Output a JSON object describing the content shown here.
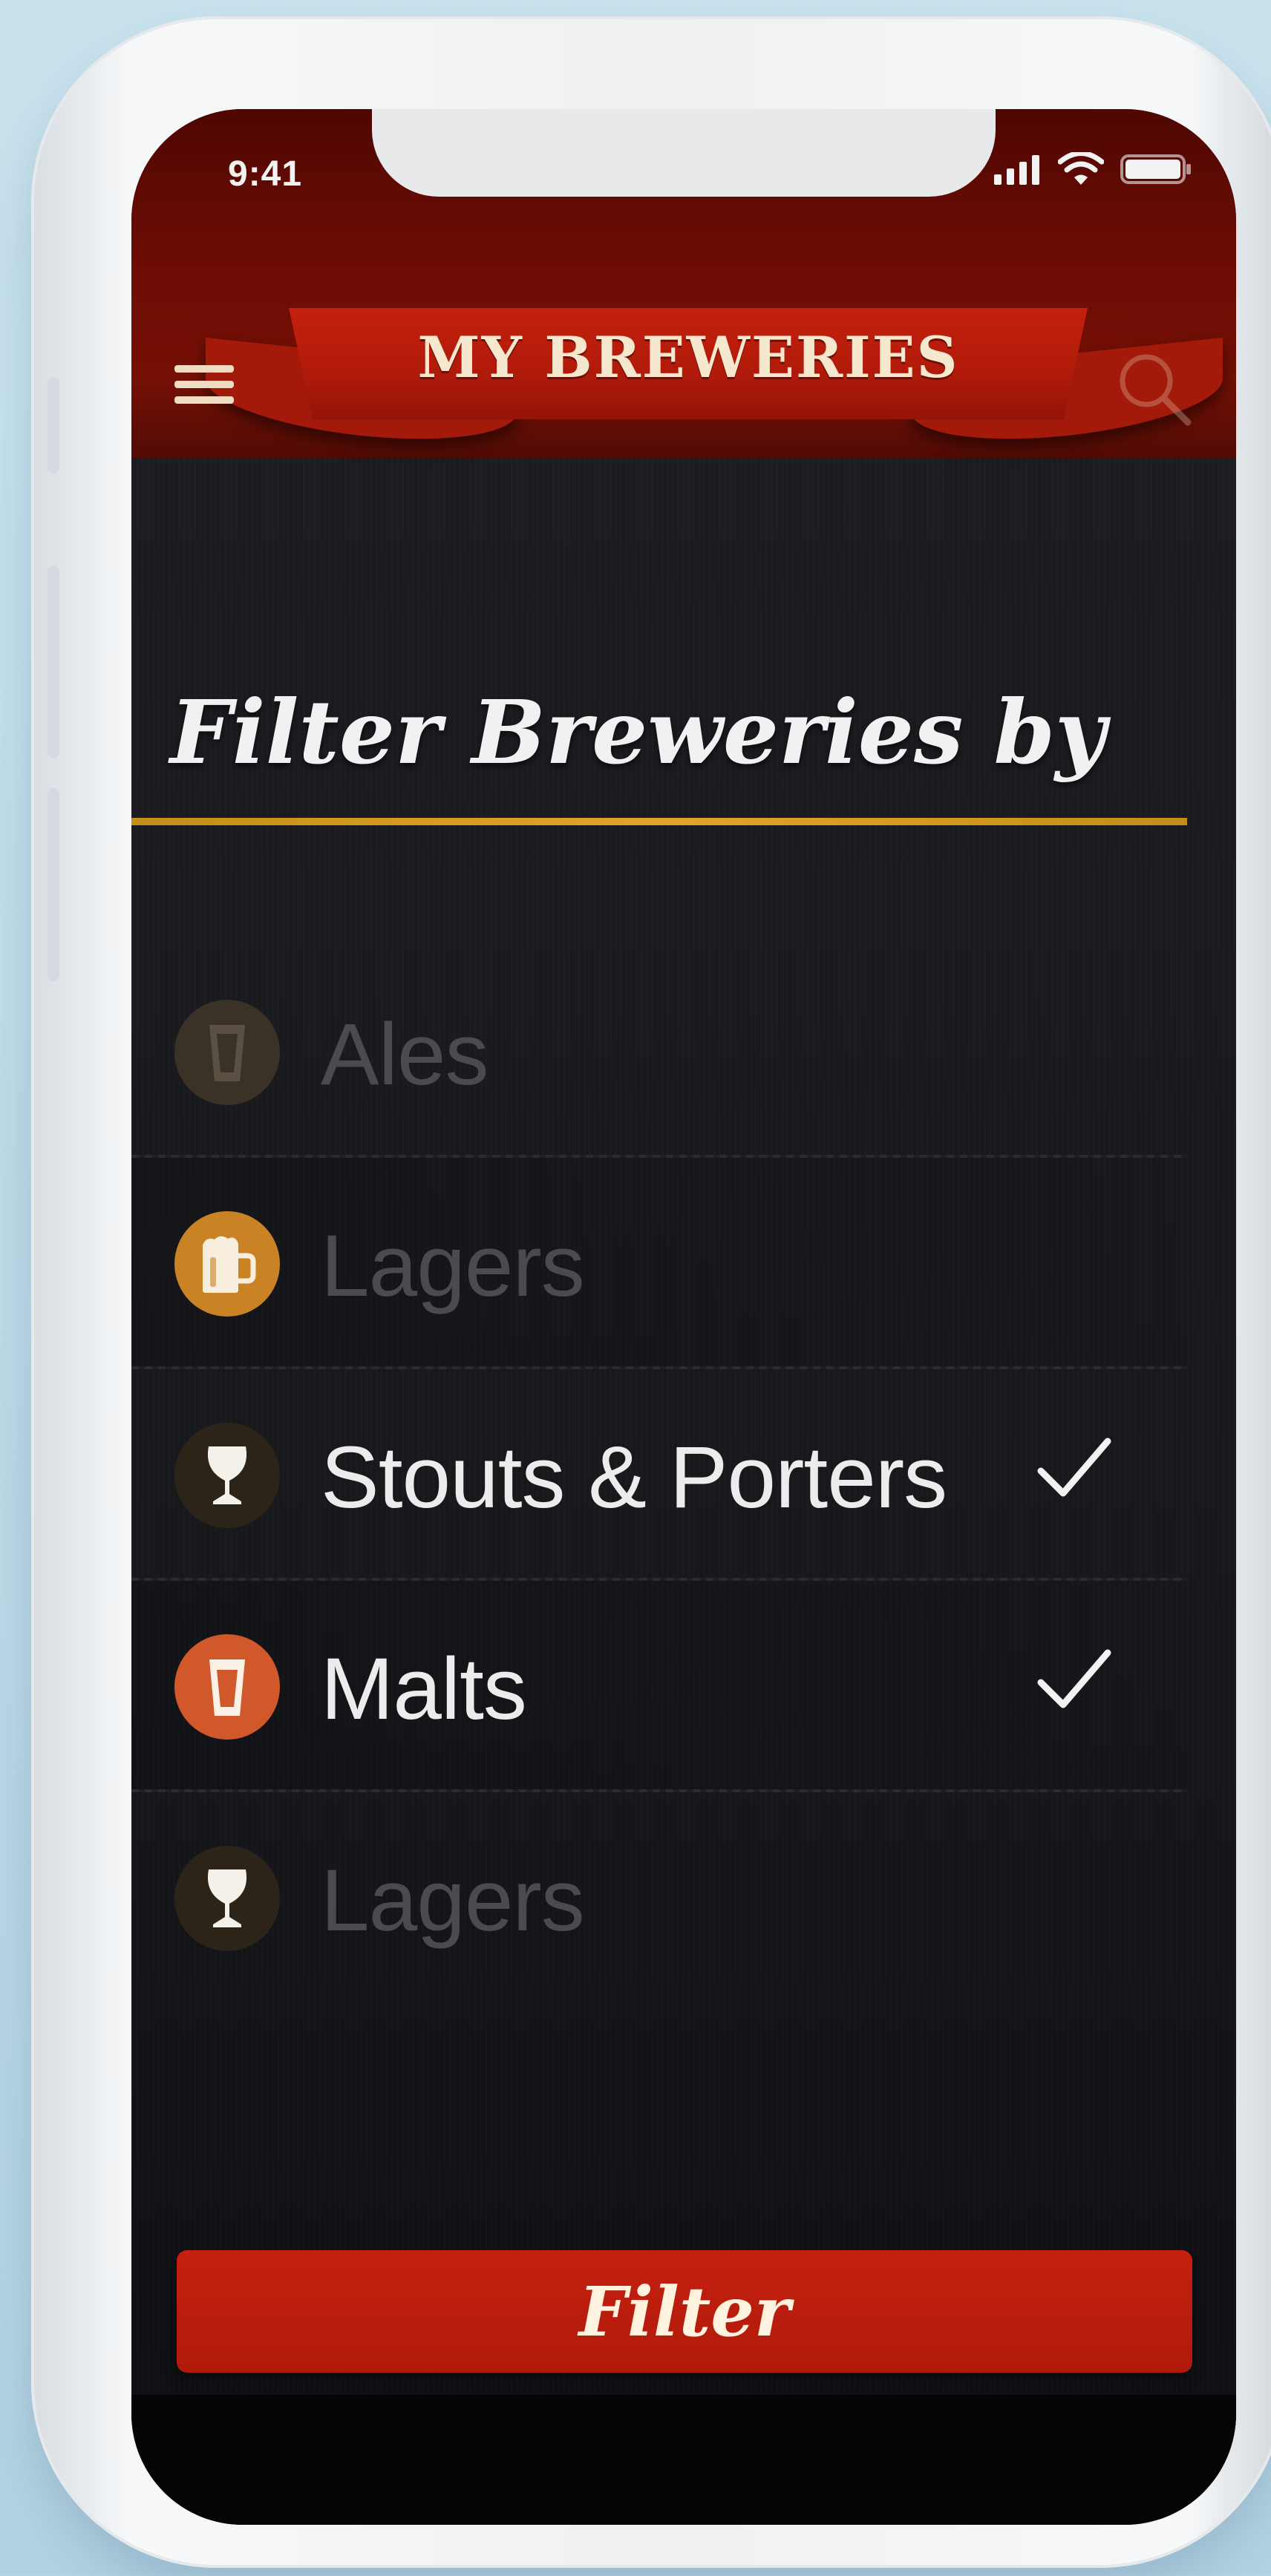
{
  "status_bar": {
    "time": "9:41",
    "icons": [
      "cellular-signal-icon",
      "wifi-icon",
      "battery-icon"
    ]
  },
  "header": {
    "title": "MY BREWERIES",
    "left_icon": "hamburger-menu-icon",
    "right_icon": "search-icon"
  },
  "filter": {
    "heading": "Filter Breweries by",
    "options": [
      {
        "label": "Ales",
        "icon": "pint-glass-icon",
        "badge_color": "#3a3226",
        "selected": false
      },
      {
        "label": "Lagers",
        "icon": "beer-mug-icon",
        "badge_color": "#c98324",
        "selected": false
      },
      {
        "label": "Stouts & Porters",
        "icon": "snifter-glass-icon",
        "badge_color": "#2c2418",
        "selected": true
      },
      {
        "label": "Malts",
        "icon": "pint-glass-icon",
        "badge_color": "#d0582a",
        "selected": true
      },
      {
        "label": "Lagers",
        "icon": "snifter-glass-icon",
        "badge_color": "#2c2418",
        "selected": false
      }
    ],
    "button_label": "Filter"
  },
  "colors": {
    "header_red": "#7d1206",
    "ribbon_red": "#b01a0a",
    "gold_rule": "#e1a52a",
    "check": "#f2f2f2"
  }
}
